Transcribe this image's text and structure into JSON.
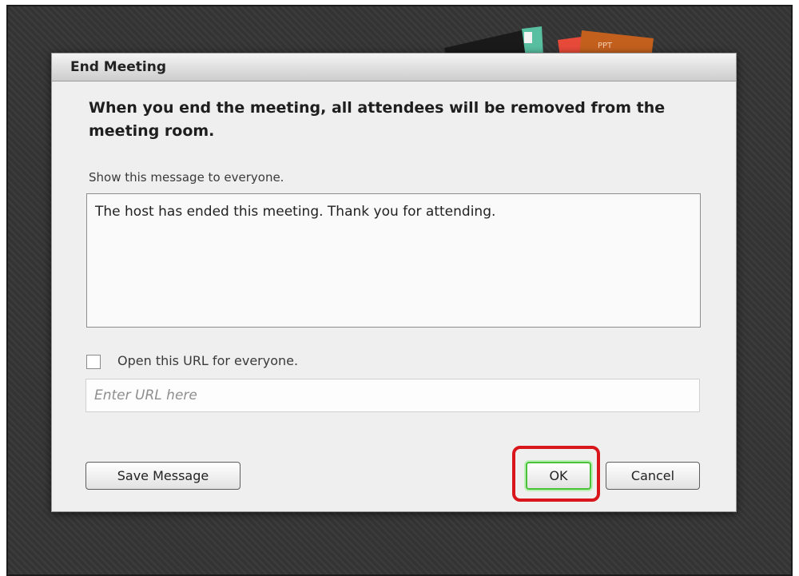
{
  "dialog": {
    "title": "End Meeting",
    "warning": "When you end the meeting, all attendees will be removed from the meeting room.",
    "message_label": "Show this message to everyone.",
    "message_text": "The host has ended this meeting. Thank you for attending.",
    "url_checkbox_label": "Open this URL for everyone.",
    "url_checkbox_checked": false,
    "url_placeholder": "Enter URL here",
    "url_value": ""
  },
  "buttons": {
    "save_label": "Save Message",
    "ok_label": "OK",
    "cancel_label": "Cancel"
  },
  "background_pod": {
    "tag_label": "PPT"
  },
  "colors": {
    "ok_focus_ring": "#49c23a",
    "highlight_box": "#d8161c",
    "backdrop": "#343434"
  }
}
